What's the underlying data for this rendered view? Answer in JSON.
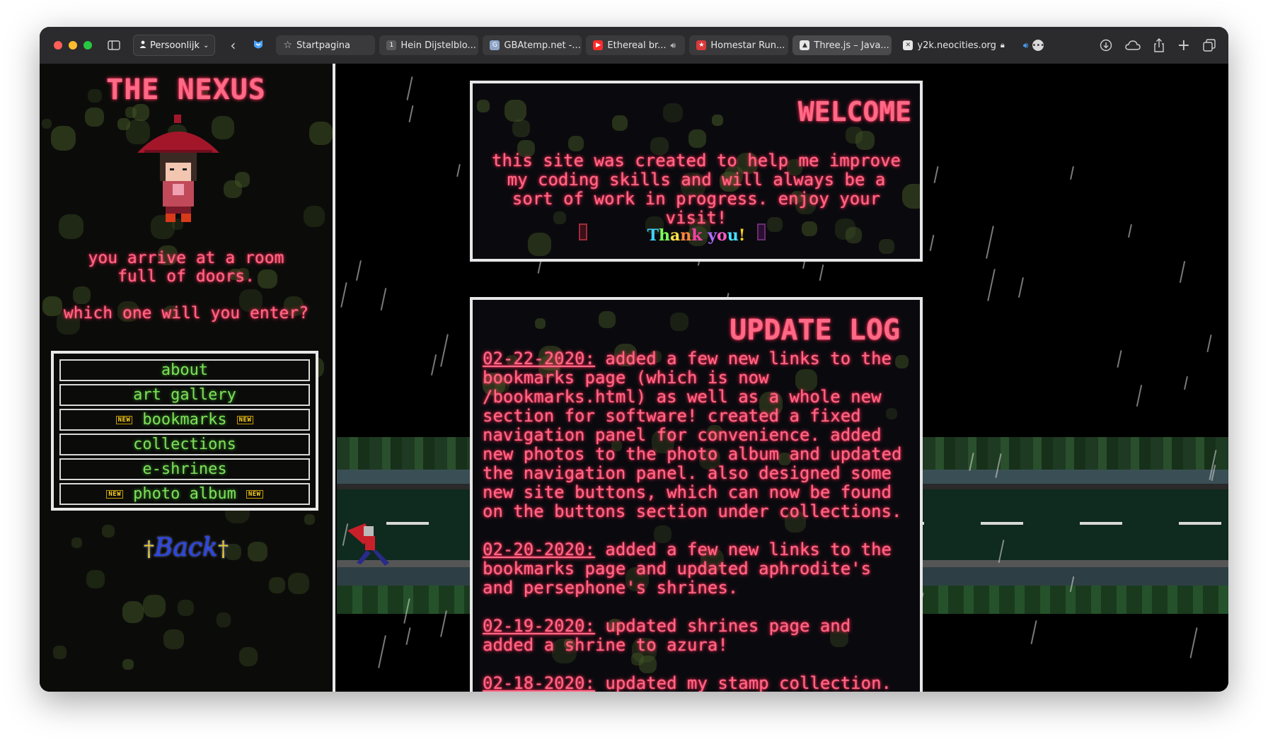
{
  "browser": {
    "profile_label": "Persoonlijk",
    "tabs": [
      {
        "label": "Startpagina",
        "icon": "star-icon"
      },
      {
        "label": "Hein Dijstelblo...",
        "icon": "page-icon"
      },
      {
        "label": "GBAtemp.net -...",
        "icon": "gba-icon"
      },
      {
        "label": "Ethereal br...",
        "icon": "youtube-icon"
      },
      {
        "label": "Homestar Run...",
        "icon": "homestar-icon"
      },
      {
        "label": "Three.js – Java...",
        "icon": "threejs-icon"
      },
      {
        "label": "y2k.neocities.org",
        "icon": "neocities-icon"
      }
    ],
    "colors": {
      "titlebar": "#2b2b2d",
      "tab": "#3a3a3c",
      "active_tab": "#4a4a4d"
    }
  },
  "sidebar": {
    "title": "THE NEXUS",
    "intro_line1": "you arrive at a room",
    "intro_line2": "full of doors.",
    "intro_question": "which one will you enter?",
    "nav": [
      {
        "label": "about",
        "new": false
      },
      {
        "label": "art gallery",
        "new": false
      },
      {
        "label": "bookmarks",
        "new": true
      },
      {
        "label": "collections",
        "new": false
      },
      {
        "label": "e-shrines",
        "new": false
      },
      {
        "label": "photo album",
        "new": true
      }
    ],
    "new_badge": "NEW",
    "back_label": "Back",
    "back_cross": "†"
  },
  "welcome": {
    "title": "WELCOME",
    "text": "this site was created to help me improve my coding skills and will always be a sort of work in progress. enjoy your visit!",
    "thanks_letters": [
      "T",
      "h",
      "a",
      "n",
      "k",
      " ",
      "y",
      "o",
      "u",
      "!"
    ]
  },
  "update_log": {
    "title": "UPDATE LOG",
    "entries": [
      {
        "date": "02-22-2020:",
        "text": " added a few new links to the bookmarks page (which is now /bookmarks.html) as well as a whole new section for software! created a fixed navigation panel for convenience. added new photos to the photo album and updated the navigation panel. also designed some new site buttons, which can now be found on the buttons section under collections."
      },
      {
        "date": "02-20-2020:",
        "text": " added a few new links to the bookmarks page and updated aphrodite's and persephone's shrines."
      },
      {
        "date": "02-19-2020:",
        "text": " updated shrines page and added a shrine to azura!"
      },
      {
        "date": "02-18-2020:",
        "text": " updated my stamp collection."
      }
    ]
  },
  "theme": {
    "pink": "#ff6a86",
    "green": "#7ee05a",
    "back_blue": "#2b45e8",
    "rainbow": [
      "#3fd2ff",
      "#7dff5a",
      "#ffe14a",
      "#ff8a3a",
      "#ff3fa8",
      "#ffffff",
      "#b06cff",
      "#ff5ac8",
      "#4ae0ff",
      "#ffd21e"
    ]
  }
}
